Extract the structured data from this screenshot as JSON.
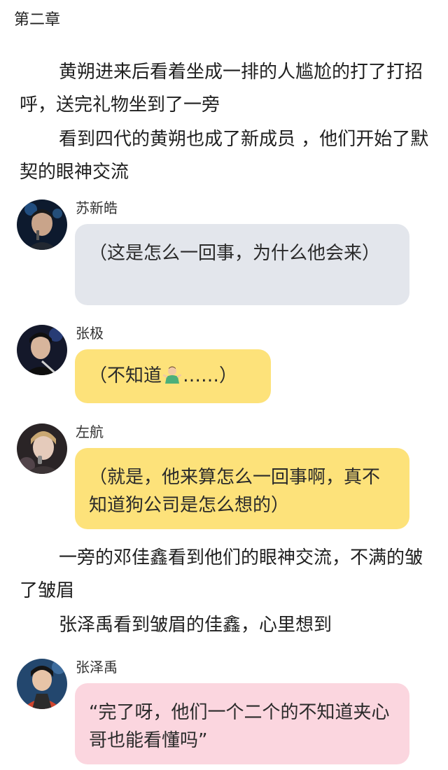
{
  "chapter_title": "第二章",
  "paragraphs": [
    "黄朔进来后看着坐成一排的人尴尬的打了打招呼，送完礼物坐到了一旁",
    "看到四代的黄朔也成了新成员 ，他们开始了默契的眼神交流",
    "一旁的邓佳鑫看到他们的眼神交流，不满的皱了皱眉",
    "张泽禹看到皱眉的佳鑫，心里想到"
  ],
  "messages": [
    {
      "sender": "苏新皓",
      "text": "（这是怎么一回事，为什么他会来）",
      "bubble_color": "#e3e6ec"
    },
    {
      "sender": "张极",
      "text_before": "（不知道",
      "emoji": "person-shrugging-icon",
      "text_after": "……）",
      "bubble_color": "#fde27a"
    },
    {
      "sender": "左航",
      "text": "（就是，他来算怎么一回事啊，真不知道狗公司是怎么想的）",
      "bubble_color": "#fde27a"
    },
    {
      "sender": "张泽禹",
      "text": "“完了呀，他们一个二个的不知道夹心哥也能看懂吗”",
      "bubble_color": "#fbd6df"
    }
  ]
}
